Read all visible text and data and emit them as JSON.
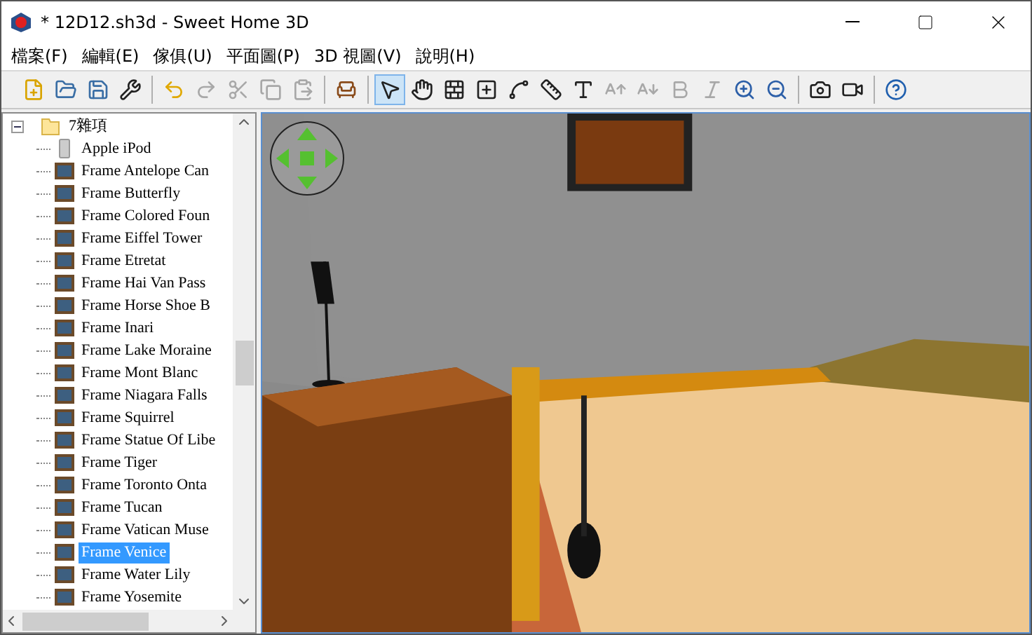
{
  "window": {
    "title": "* 12D12.sh3d - Sweet Home 3D"
  },
  "menu": [
    "檔案(F)",
    "編輯(E)",
    "傢俱(U)",
    "平面圖(P)",
    "3D 視圖(V)",
    "說明(H)"
  ],
  "toolbar": [
    {
      "kind": "new",
      "disabled": false,
      "selected": false
    },
    {
      "kind": "open",
      "disabled": false,
      "selected": false
    },
    {
      "kind": "save",
      "disabled": false,
      "selected": false
    },
    {
      "kind": "preferences",
      "disabled": false,
      "selected": false
    },
    {
      "kind": "separator"
    },
    {
      "kind": "undo",
      "disabled": false,
      "selected": false
    },
    {
      "kind": "redo",
      "disabled": true,
      "selected": false
    },
    {
      "kind": "cut",
      "disabled": true,
      "selected": false
    },
    {
      "kind": "copy",
      "disabled": true,
      "selected": false
    },
    {
      "kind": "paste",
      "disabled": true,
      "selected": false
    },
    {
      "kind": "separator"
    },
    {
      "kind": "add_furniture",
      "disabled": false,
      "selected": false
    },
    {
      "kind": "separator"
    },
    {
      "kind": "select",
      "disabled": false,
      "selected": true
    },
    {
      "kind": "pan",
      "disabled": false,
      "selected": false
    },
    {
      "kind": "walls",
      "disabled": false,
      "selected": false
    },
    {
      "kind": "rooms",
      "disabled": false,
      "selected": false
    },
    {
      "kind": "polylines",
      "disabled": false,
      "selected": false
    },
    {
      "kind": "dimensions",
      "disabled": false,
      "selected": false
    },
    {
      "kind": "text",
      "disabled": false,
      "selected": false
    },
    {
      "kind": "text_bigger",
      "disabled": true,
      "selected": false
    },
    {
      "kind": "text_smaller",
      "disabled": true,
      "selected": false
    },
    {
      "kind": "bold",
      "disabled": true,
      "selected": false
    },
    {
      "kind": "italic",
      "disabled": true,
      "selected": false
    },
    {
      "kind": "zoom_in",
      "disabled": false,
      "selected": false
    },
    {
      "kind": "zoom_out",
      "disabled": false,
      "selected": false
    },
    {
      "kind": "separator"
    },
    {
      "kind": "photo",
      "disabled": false,
      "selected": false
    },
    {
      "kind": "video",
      "disabled": false,
      "selected": false
    },
    {
      "kind": "separator"
    },
    {
      "kind": "help",
      "disabled": false,
      "selected": false
    }
  ],
  "catalog": {
    "label": "7雜項",
    "expanded": true,
    "children": [
      {
        "label": "Apple iPod",
        "kind": "device",
        "selected": false
      },
      {
        "label": "Frame Antelope Can",
        "kind": "frame",
        "selected": false
      },
      {
        "label": "Frame Butterfly",
        "kind": "frame",
        "selected": false
      },
      {
        "label": "Frame Colored Foun",
        "kind": "frame",
        "selected": false
      },
      {
        "label": "Frame Eiffel Tower",
        "kind": "frame",
        "selected": false
      },
      {
        "label": "Frame Etretat",
        "kind": "frame",
        "selected": false
      },
      {
        "label": "Frame Hai Van Pass",
        "kind": "frame",
        "selected": false
      },
      {
        "label": "Frame Horse Shoe B",
        "kind": "frame",
        "selected": false
      },
      {
        "label": "Frame Inari",
        "kind": "frame",
        "selected": false
      },
      {
        "label": "Frame Lake Moraine",
        "kind": "frame",
        "selected": false
      },
      {
        "label": "Frame Mont Blanc",
        "kind": "frame",
        "selected": false
      },
      {
        "label": "Frame Niagara Falls",
        "kind": "frame",
        "selected": false
      },
      {
        "label": "Frame Squirrel",
        "kind": "frame",
        "selected": false
      },
      {
        "label": "Frame Statue Of Libe",
        "kind": "frame",
        "selected": false
      },
      {
        "label": "Frame Tiger",
        "kind": "frame",
        "selected": false
      },
      {
        "label": "Frame Toronto Onta",
        "kind": "frame",
        "selected": false
      },
      {
        "label": "Frame Tucan",
        "kind": "frame",
        "selected": false
      },
      {
        "label": "Frame Vatican Muse",
        "kind": "frame",
        "selected": false
      },
      {
        "label": "Frame Venice",
        "kind": "frame",
        "selected": true
      },
      {
        "label": "Frame Water Lily",
        "kind": "frame",
        "selected": false
      },
      {
        "label": "Frame Yosemite",
        "kind": "frame",
        "selected": false
      }
    ]
  }
}
